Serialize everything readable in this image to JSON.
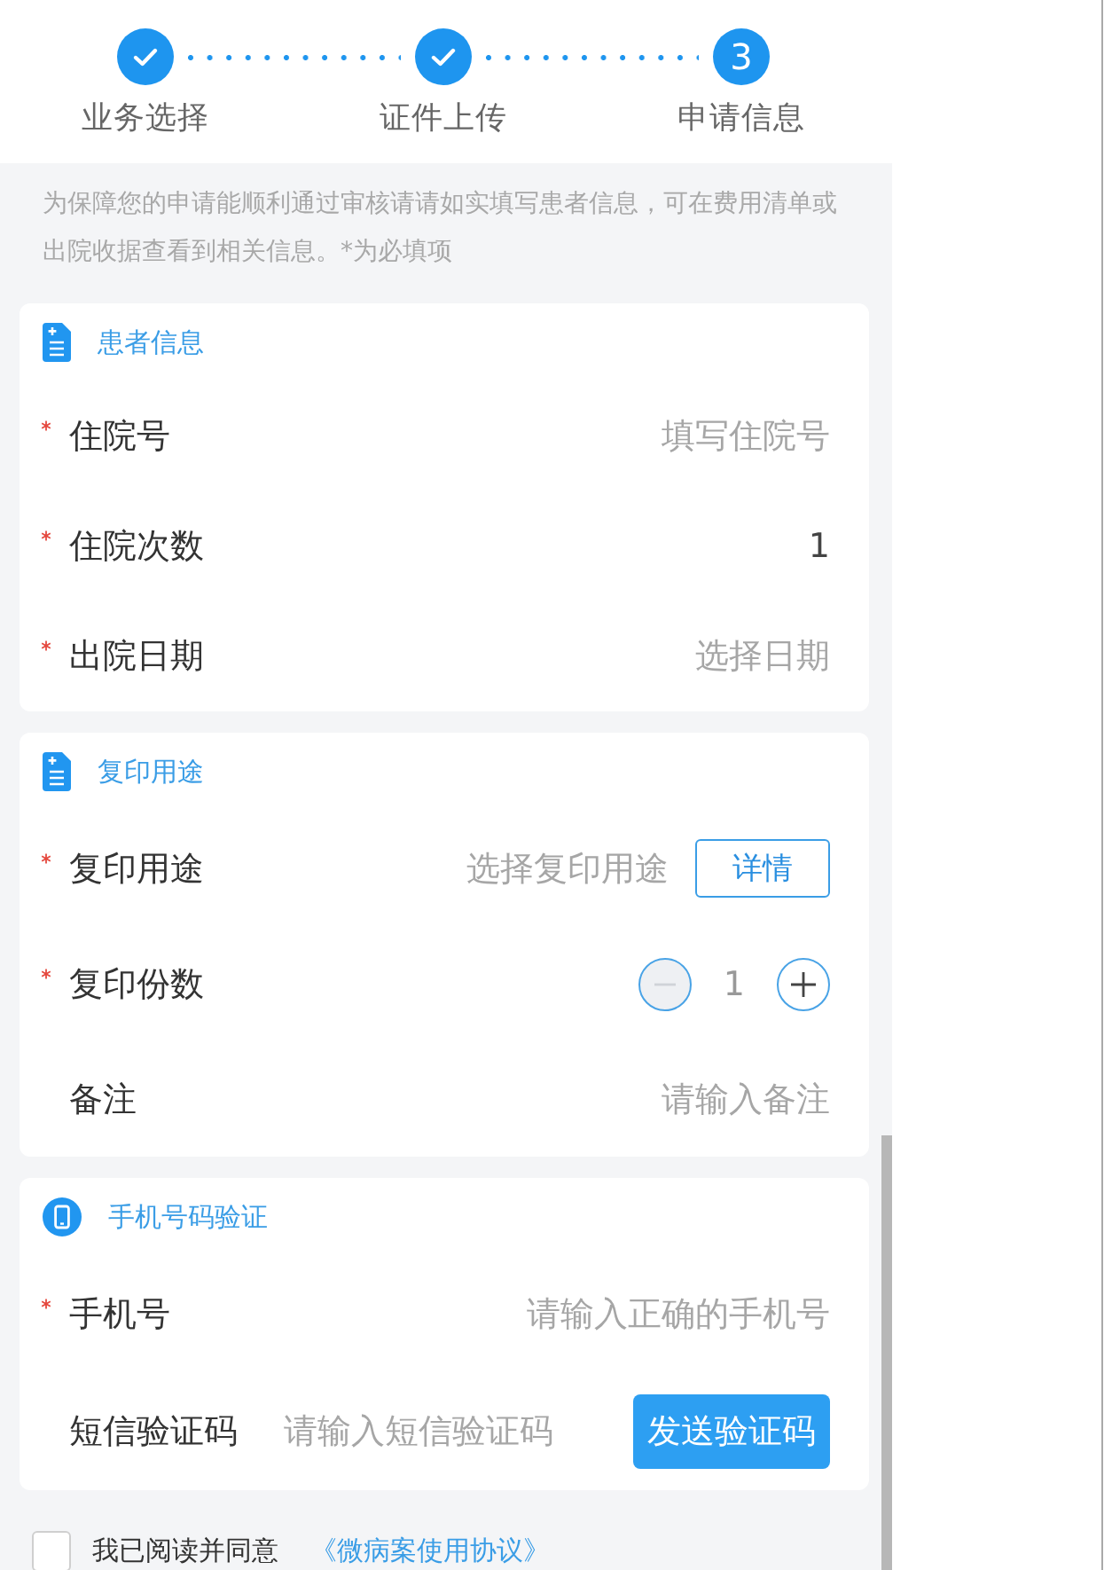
{
  "steps": [
    {
      "label": "业务选择",
      "completed": true
    },
    {
      "label": "证件上传",
      "completed": true
    },
    {
      "label": "申请信息",
      "completed": false,
      "number": "3"
    }
  ],
  "notice": "为保障您的申请能顺利通过审核请请如实填写患者信息，可在费用清单或出院收据查看到相关信息。*为必填项",
  "sections": [
    {
      "title": "患者信息",
      "kind": "form",
      "fields": [
        {
          "kind": "input",
          "label": "住院号",
          "required": true,
          "placeholder": "填写住院号"
        },
        {
          "kind": "input",
          "label": "住院次数",
          "required": true,
          "value": "1"
        },
        {
          "kind": "input",
          "label": "出院日期",
          "required": true,
          "placeholder": "选择日期"
        }
      ]
    },
    {
      "title": "复印用途",
      "kind": "form",
      "fields": [
        {
          "kind": "select",
          "label": "复印用途",
          "required": true,
          "placeholder": "选择复印用途",
          "button": "详情"
        },
        {
          "kind": "stepper",
          "label": "复印份数",
          "required": true,
          "value": "1",
          "decrement_disabled": true
        },
        {
          "kind": "input",
          "label": "备注",
          "required": false,
          "placeholder": "请输入备注"
        }
      ]
    },
    {
      "title": "手机号码验证",
      "kind": "verification",
      "fields": [
        {
          "kind": "input",
          "label": "手机号",
          "required": true,
          "placeholder": "请输入正确的手机号"
        },
        {
          "kind": "code",
          "label": "短信验证码",
          "required": false,
          "placeholder": "请输入短信验证码",
          "button": "发送验证码"
        }
      ]
    }
  ],
  "agreement": {
    "checked": false,
    "text": "我已阅读并同意",
    "link": "《微病案使用协议》"
  }
}
